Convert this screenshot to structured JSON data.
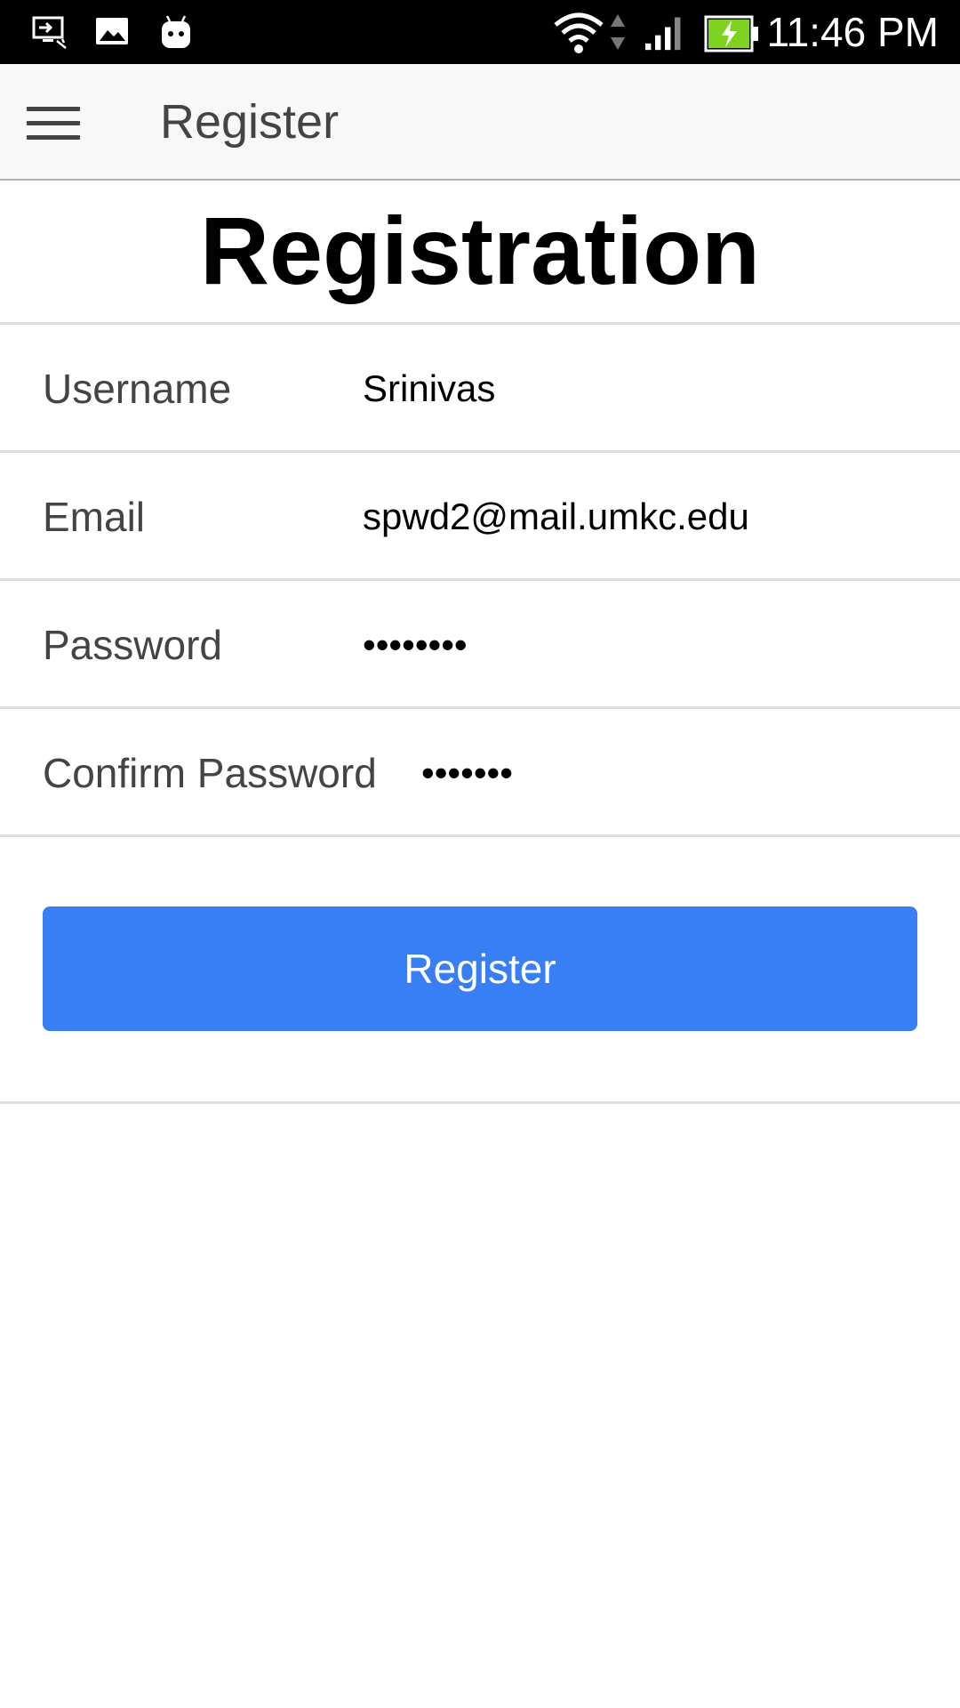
{
  "status_bar": {
    "time": "11:46 PM",
    "icons": [
      "cast-screen-icon",
      "image-icon",
      "android-icon",
      "wifi-icon",
      "data-arrows-icon",
      "cell-signal-icon",
      "battery-charging-icon"
    ],
    "battery_fill_color": "#7ed321"
  },
  "toolbar": {
    "menu_icon": "menu-icon",
    "title": "Register"
  },
  "main": {
    "heading": "Registration",
    "fields": {
      "username": {
        "label": "Username",
        "value": "Srinivas"
      },
      "email": {
        "label": "Email",
        "value": "spwd2@mail.umkc.edu"
      },
      "password": {
        "label": "Password",
        "value": "********"
      },
      "confirm_password": {
        "label": "Confirm Password",
        "value": "*******"
      }
    },
    "register_button_label": "Register"
  },
  "colors": {
    "primary": "#387ef5",
    "toolbar_bg": "#f8f8f8",
    "status_bar_bg": "#000000",
    "divider": "#dedede",
    "label_text": "#444444"
  }
}
